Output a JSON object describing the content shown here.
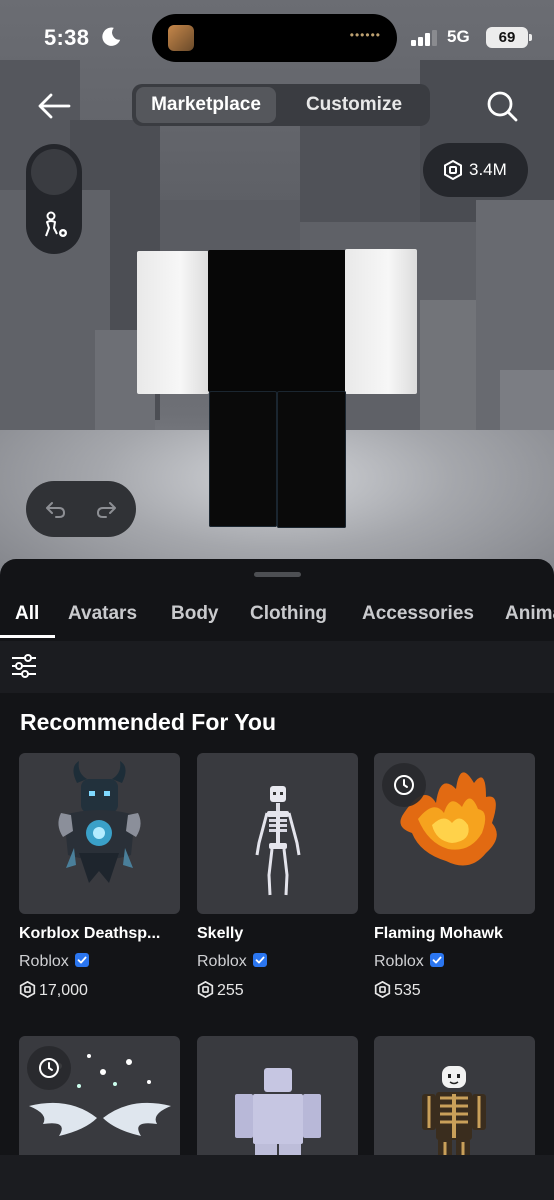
{
  "status_bar": {
    "time": "5:38",
    "network": "5G",
    "battery": "69"
  },
  "header": {
    "tabs": [
      {
        "label": "Marketplace",
        "active": true
      },
      {
        "label": "Customize",
        "active": false
      }
    ],
    "icons": {
      "back": "arrow-left-icon",
      "search": "search-icon"
    }
  },
  "scene": {
    "robux_balance": "3.4M",
    "controls": {
      "undo": "undo-icon",
      "redo": "redo-icon",
      "avatar_settings": "avatar-settings-icon"
    }
  },
  "categories": [
    "All",
    "Avatars",
    "Body",
    "Clothing",
    "Accessories",
    "Animations"
  ],
  "active_category": "All",
  "section": {
    "title": "Recommended For You",
    "items": [
      {
        "name": "Korblox Deathsp...",
        "creator": "Roblox",
        "verified": true,
        "price": "17,000",
        "limited_time": false
      },
      {
        "name": "Skelly",
        "creator": "Roblox",
        "verified": true,
        "price": "255",
        "limited_time": false
      },
      {
        "name": "Flaming Mohawk",
        "creator": "Roblox",
        "verified": true,
        "price": "535",
        "limited_time": true
      },
      {
        "name": "",
        "creator": "",
        "verified": false,
        "price": "",
        "limited_time": true
      },
      {
        "name": "",
        "creator": "",
        "verified": false,
        "price": "",
        "limited_time": false
      },
      {
        "name": "",
        "creator": "",
        "verified": false,
        "price": "",
        "limited_time": false
      }
    ]
  },
  "colors": {
    "sheet_bg": "#131417",
    "card_bg": "#393a3f",
    "verified_blue": "#2b76f0",
    "pill_bg": "#25272c"
  }
}
